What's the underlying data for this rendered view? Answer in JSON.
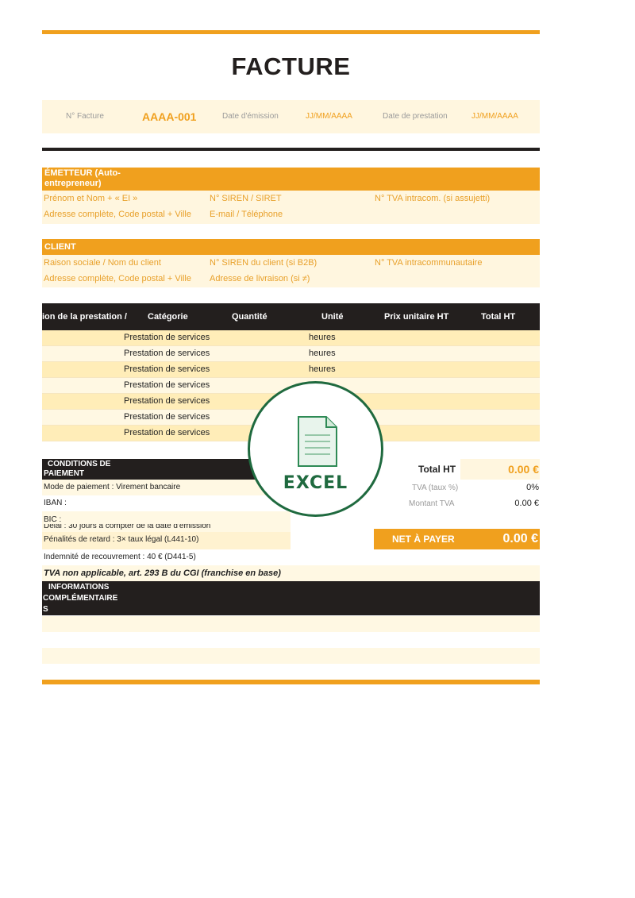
{
  "header": {
    "title": "FACTURE"
  },
  "invoice_info": {
    "number_label": "N° Facture",
    "number_value": "AAAA-001",
    "issue_date_label": "Date d'émission",
    "issue_date_value": "JJ/MM/AAAA",
    "service_date_label": "Date de prestation",
    "service_date_value": "JJ/MM/AAAA"
  },
  "emitter": {
    "heading_line1": "ÉMETTEUR (Auto-",
    "heading_line2": "entrepreneur)",
    "name": "Prénom et Nom + « EI »",
    "siren": "N° SIREN / SIRET",
    "vat": "N° TVA intracom. (si assujetti)",
    "address": "Adresse complète, Code postal + Ville",
    "contact": "E-mail / Téléphone"
  },
  "client": {
    "heading": "CLIENT",
    "name": "Raison sociale / Nom du client",
    "siren": "N° SIREN du client (si B2B)",
    "vat": "N° TVA intracommunautaire",
    "address": "Adresse complète, Code postal + Ville",
    "delivery": "Adresse de livraison (si ≠)"
  },
  "table": {
    "headers": [
      "ion de la prestation /",
      "Catégorie",
      "Quantité",
      "Unité",
      "Prix unitaire HT",
      "Total HT"
    ],
    "rows": [
      {
        "category": "Prestation de services",
        "unit": "heures"
      },
      {
        "category": "Prestation de services",
        "unit": "heures"
      },
      {
        "category": "Prestation de services",
        "unit": "heures"
      },
      {
        "category": "Prestation de services",
        "unit": ""
      },
      {
        "category": "Prestation de services",
        "unit": ""
      },
      {
        "category": "Prestation de services",
        "unit": ""
      },
      {
        "category": "Prestation de services",
        "unit": ""
      }
    ]
  },
  "conditions": {
    "heading_line1": "CONDITIONS DE",
    "heading_line2": "PAIEMENT",
    "payment_mode": "Mode de paiement : Virement bancaire",
    "iban": "IBAN :",
    "bic": "BIC :",
    "delay": "Délai : 30 jours à compter de la date d'émission",
    "late_penalties": "Pénalités de retard : 3× taux légal (L441-10)",
    "recovery_fee": "Indemnité de recouvrement : 40 € (D441-5)"
  },
  "totals": {
    "total_ht_label": "Total HT",
    "total_ht_value": "0.00 €",
    "vat_rate_label": "TVA (taux %)",
    "vat_rate_value": "0%",
    "vat_amount_label": "Montant TVA",
    "vat_amount_value": "0.00 €",
    "net_label": "NET À PAYER",
    "net_value": "0.00 €"
  },
  "vat_notice": "TVA non applicable, art. 293 B du CGI (franchise en base)",
  "additional_info": {
    "heading_line1": "INFORMATIONS",
    "heading_line2": "COMPLÉMENTAIRE",
    "heading_line3": "S"
  },
  "watermark": {
    "label": "EXCEL",
    "icon": "spreadsheet-document-icon"
  },
  "colors": {
    "accent": "#f0a01e",
    "dark": "#231f1e",
    "light_fill": "#fff6df",
    "row_fill": "#ffedb8",
    "badge_green": "#1f6a3f"
  }
}
